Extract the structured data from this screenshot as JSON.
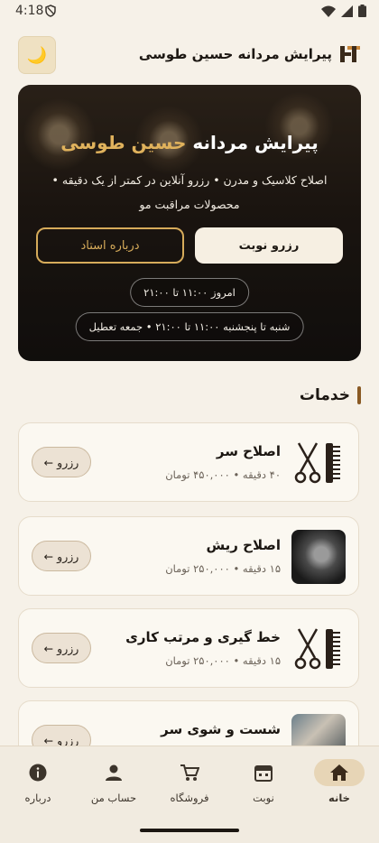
{
  "status_bar": {
    "time": "4:18"
  },
  "header": {
    "brand_name": "پیرایش مردانه حسین طوسی",
    "theme_toggle_icon": "moon-icon"
  },
  "hero": {
    "title_main": "پیرایش مردانه ",
    "title_accent": "حسین طوسی",
    "description": "اصلاح کلاسیک و مدرن • رزرو آنلاین در کمتر از یک دقیقه • محصولات مراقبت مو",
    "book_button": "رزرو نوبت",
    "about_button": "درباره استاد",
    "hours_today": "امروز ۱۱:۰۰ تا ۲۱:۰۰",
    "hours_week": "شنبه تا پنجشنبه ۱۱:۰۰ تا ۲۱:۰۰ • جمعه تعطیل"
  },
  "services_title": "خدمات",
  "services": [
    {
      "title": "اصلاح سر",
      "meta": "۴۰ دقیقه • ۴۵۰,۰۰۰ تومان",
      "book_label": "رزرو",
      "icon": "scissors-comb-icon"
    },
    {
      "title": "اصلاح ریش",
      "meta": "۱۵ دقیقه • ۲۵۰,۰۰۰ تومان",
      "book_label": "رزرو",
      "icon": "beard-photo"
    },
    {
      "title": "خط گیری و مرتب کاری",
      "meta": "۱۵ دقیقه • ۲۵۰,۰۰۰ تومان",
      "book_label": "رزرو",
      "icon": "scissors-comb-icon"
    },
    {
      "title": "شست و شوی سر",
      "meta": "",
      "book_label": "رزرو",
      "icon": "wash-photo"
    }
  ],
  "bottom_nav": [
    {
      "label": "خانه",
      "icon": "home-icon",
      "active": true
    },
    {
      "label": "نوبت",
      "icon": "calendar-icon",
      "active": false
    },
    {
      "label": "فروشگاه",
      "icon": "cart-icon",
      "active": false
    },
    {
      "label": "حساب من",
      "icon": "person-icon",
      "active": false
    },
    {
      "label": "درباره",
      "icon": "info-icon",
      "active": false
    }
  ]
}
